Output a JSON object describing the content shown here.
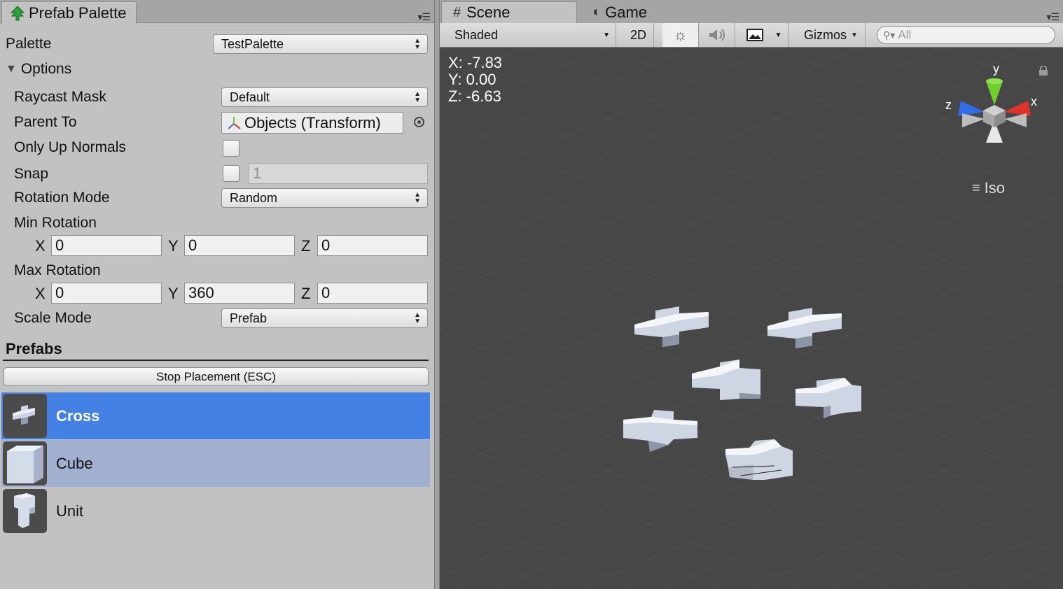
{
  "left_panel": {
    "tab_title": "Prefab Palette",
    "palette_label": "Palette",
    "palette_value": "TestPalette",
    "options_label": "Options",
    "raycast_mask_label": "Raycast Mask",
    "raycast_mask_value": "Default",
    "parent_to_label": "Parent To",
    "parent_to_value": "Objects (Transform)",
    "only_up_normals_label": "Only Up Normals",
    "snap_label": "Snap",
    "snap_value": "1",
    "rotation_mode_label": "Rotation Mode",
    "rotation_mode_value": "Random",
    "min_rotation_label": "Min Rotation",
    "min_rotation": {
      "x_label": "X",
      "x": "0",
      "y_label": "Y",
      "y": "0",
      "z_label": "Z",
      "z": "0"
    },
    "max_rotation_label": "Max Rotation",
    "max_rotation": {
      "x_label": "X",
      "x": "0",
      "y_label": "Y",
      "y": "360",
      "z_label": "Z",
      "z": "0"
    },
    "scale_mode_label": "Scale Mode",
    "scale_mode_value": "Prefab",
    "prefabs_title": "Prefabs",
    "stop_button": "Stop Placement (ESC)",
    "prefabs": [
      {
        "name": "Cross",
        "state": "selected"
      },
      {
        "name": "Cube",
        "state": "hover"
      },
      {
        "name": "Unit",
        "state": "normal"
      }
    ]
  },
  "right_panel": {
    "tabs": [
      {
        "label": "Scene",
        "active": true
      },
      {
        "label": "Game",
        "active": false
      }
    ],
    "toolbar": {
      "shading_mode": "Shaded",
      "mode_2d": "2D",
      "gizmos": "Gizmos",
      "search_placeholder": "All"
    },
    "coords": {
      "x": "X: -7.83",
      "y": "Y: 0.00",
      "z": "Z: -6.63"
    },
    "gizmo_axes": {
      "x": "x",
      "y": "y",
      "z": "z"
    },
    "projection": "Iso"
  },
  "colors": {
    "selected_row": "#4481e4",
    "hover_row": "#a2b0cf",
    "viewport_bg": "#474747",
    "axis_x": "#e0322a",
    "axis_y": "#6fcf2c",
    "axis_z": "#2f6ee8"
  }
}
